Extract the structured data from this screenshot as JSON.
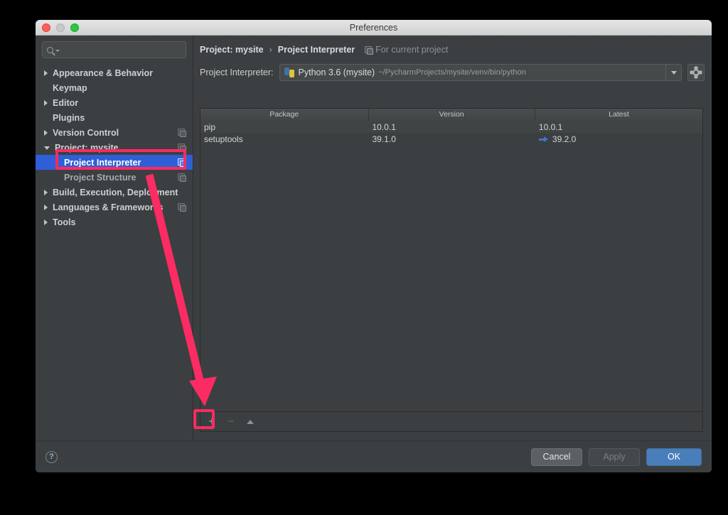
{
  "window": {
    "title": "Preferences",
    "traffic_lights": [
      "close-red",
      "minimize-gray",
      "zoom-green"
    ]
  },
  "sidebar": {
    "search": {
      "value": "",
      "placeholder": ""
    },
    "items": [
      {
        "label": "Appearance & Behavior",
        "arrow": "collapsed",
        "level": 0,
        "config_icon": false,
        "selected": false
      },
      {
        "label": "Keymap",
        "arrow": "none",
        "level": 0,
        "config_icon": false,
        "selected": false
      },
      {
        "label": "Editor",
        "arrow": "collapsed",
        "level": 0,
        "config_icon": false,
        "selected": false
      },
      {
        "label": "Plugins",
        "arrow": "none",
        "level": 0,
        "config_icon": false,
        "selected": false
      },
      {
        "label": "Version Control",
        "arrow": "collapsed",
        "level": 0,
        "config_icon": true,
        "selected": false
      },
      {
        "label": "Project: mysite",
        "arrow": "expanded",
        "level": 0,
        "config_icon": true,
        "selected": false
      },
      {
        "label": "Project Interpreter",
        "arrow": "none",
        "level": 1,
        "config_icon": true,
        "selected": true
      },
      {
        "label": "Project Structure",
        "arrow": "none",
        "level": 1,
        "config_icon": true,
        "selected": false
      },
      {
        "label": "Build, Execution, Deployment",
        "arrow": "collapsed",
        "level": 0,
        "config_icon": false,
        "selected": false
      },
      {
        "label": "Languages & Frameworks",
        "arrow": "collapsed",
        "level": 0,
        "config_icon": true,
        "selected": false
      },
      {
        "label": "Tools",
        "arrow": "collapsed",
        "level": 0,
        "config_icon": false,
        "selected": false
      }
    ]
  },
  "main": {
    "breadcrumb": {
      "project": "Project: mysite",
      "separator": "›",
      "page": "Project Interpreter",
      "scope": "For current project"
    },
    "interpreter": {
      "label": "Project Interpreter:",
      "name": "Python 3.6 (mysite)",
      "path": "~/PycharmProjects/mysite/venv/bin/python",
      "dropdown_icon": "chevron-down-icon",
      "gear_icon": "gear-icon"
    },
    "packages": {
      "columns": [
        "Package",
        "Version",
        "Latest"
      ],
      "rows": [
        {
          "package": "pip",
          "version": "10.0.1",
          "latest": "10.0.1",
          "upgradable": false
        },
        {
          "package": "setuptools",
          "version": "39.1.0",
          "latest": "39.2.0",
          "upgradable": true
        }
      ]
    },
    "toolbar": {
      "add": "+",
      "remove": "−",
      "upgrade": "upgrade-icon"
    }
  },
  "footer": {
    "help": "?",
    "cancel": "Cancel",
    "apply": "Apply",
    "ok": "OK"
  },
  "annotations": {
    "highlight_color": "#fb2b63",
    "selected_color": "#2f5fd7",
    "upgrade_arrow_color": "#3c78c8",
    "ok_button_color": "#4a7ebb"
  }
}
